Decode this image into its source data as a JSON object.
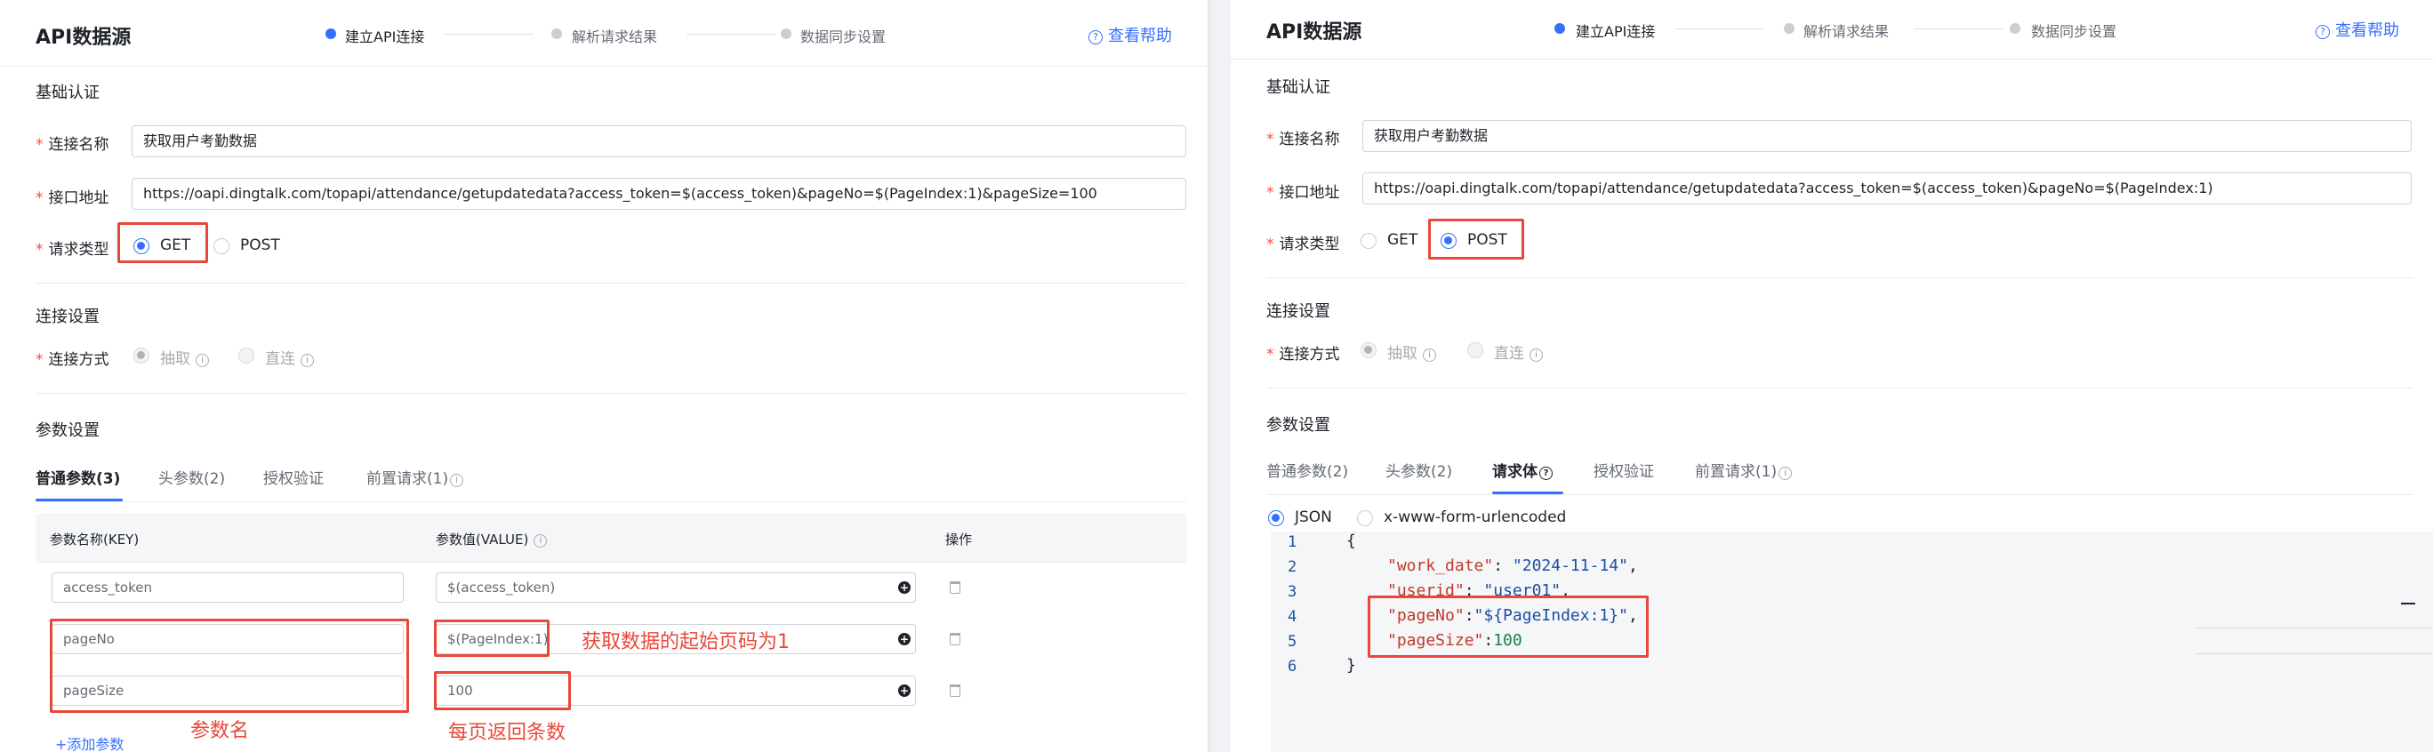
{
  "left": {
    "title": "API数据源",
    "steps": [
      "建立API连接",
      "解析请求结果",
      "数据同步设置"
    ],
    "help": "查看帮助",
    "basic_auth": "基础认证",
    "conn_name_label": "连接名称",
    "conn_name_value": "获取用户考勤数据",
    "url_label": "接口地址",
    "url_value": "https://oapi.dingtalk.com/topapi/attendance/getupdatedata?access_token=$(access_token)&pageNo=$(PageIndex:1)&pageSize=100",
    "req_type_label": "请求类型",
    "req_get": "GET",
    "req_post": "POST",
    "conn_settings": "连接设置",
    "conn_mode_label": "连接方式",
    "mode_extract": "抽取",
    "mode_direct": "直连",
    "param_settings": "参数设置",
    "tabs": [
      "普通参数(3)",
      "头参数(2)",
      "授权验证",
      "前置请求(1)"
    ],
    "col_key": "参数名称(KEY)",
    "col_value": "参数值(VALUE)",
    "col_action": "操作",
    "rows": [
      {
        "key": "access_token",
        "value": "$(access_token)"
      },
      {
        "key": "pageNo",
        "value": "$(PageIndex:1)"
      },
      {
        "key": "pageSize",
        "value": "100"
      }
    ],
    "add_param": "+添加参数",
    "annot_start_page": "获取数据的起始页码为1",
    "annot_param_name": "参数名",
    "annot_page_size": "每页返回条数"
  },
  "right": {
    "title": "API数据源",
    "steps": [
      "建立API连接",
      "解析请求结果",
      "数据同步设置"
    ],
    "help": "查看帮助",
    "basic_auth": "基础认证",
    "conn_name_label": "连接名称",
    "conn_name_value": "获取用户考勤数据",
    "url_label": "接口地址",
    "url_value": "https://oapi.dingtalk.com/topapi/attendance/getupdatedata?access_token=$(access_token)&pageNo=$(PageIndex:1)",
    "req_type_label": "请求类型",
    "req_get": "GET",
    "req_post": "POST",
    "conn_settings": "连接设置",
    "conn_mode_label": "连接方式",
    "mode_extract": "抽取",
    "mode_direct": "直连",
    "param_settings": "参数设置",
    "tabs": [
      "普通参数(2)",
      "头参数(2)",
      "请求体",
      "授权验证",
      "前置请求(1)"
    ],
    "body_json": "JSON",
    "body_form": "x-www-form-urlencoded",
    "code": {
      "line_numbers": [
        "1",
        "2",
        "3",
        "4",
        "5",
        "6"
      ],
      "open": "{",
      "k1": "\"work_date\"",
      "v1": "\"2024-11-14\"",
      "k2": "\"userid\"",
      "v2": "\"user01\"",
      "k3": "\"pageNo\"",
      "v3": "\"${PageIndex:1}\"",
      "k4": "\"pageSize\"",
      "v4": "100",
      "close": "}"
    }
  },
  "colors": {
    "accent": "#3370ff",
    "annotation": "#e8483b",
    "required": "#f54a45"
  }
}
